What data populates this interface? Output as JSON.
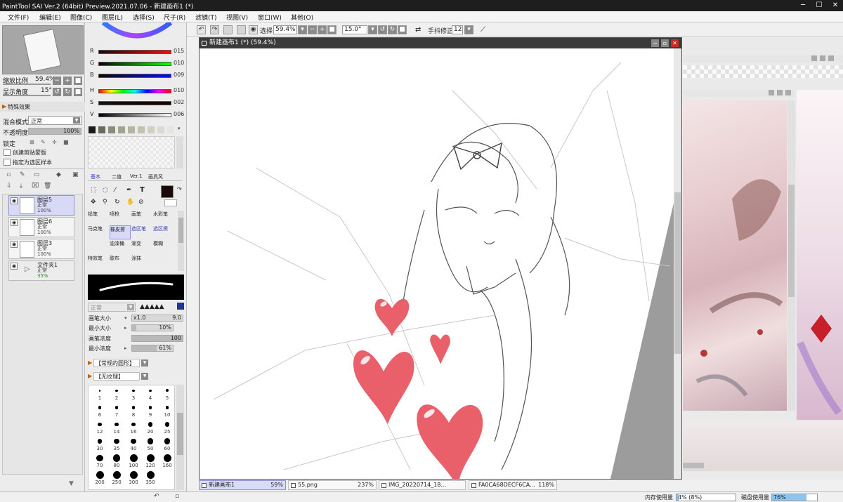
{
  "window": {
    "title": "PaintTool SAI Ver.2 (64bit) Preview.2021.07.06 - 新建画布1 (*)",
    "min": "─",
    "max": "☐",
    "close": "✕"
  },
  "menu": [
    "文件(F)",
    "编辑(E)",
    "图像(C)",
    "图层(L)",
    "选择(S)",
    "尺子(R)",
    "滤镜(T)",
    "视图(V)",
    "窗口(W)",
    "其他(O)"
  ],
  "navigator": {
    "zoom_label": "缩放比例",
    "zoom_value": "59.4%",
    "angle_label": "显示角度",
    "angle_value": "15°",
    "zoom_fraction": 0.594
  },
  "effects": {
    "label": "特殊效果"
  },
  "layer_props": {
    "blend_label": "混合模式",
    "blend_value": "正常",
    "opacity_label": "不透明度",
    "opacity_value": "100%",
    "lock_label": "锁定",
    "clip_label": "创建剪贴蒙版",
    "select_src_label": "指定为选区样本"
  },
  "layers": [
    {
      "name": "图层5",
      "mode": "正常",
      "opacity": "100%",
      "selected": true,
      "visible": true
    },
    {
      "name": "图层6",
      "mode": "正常",
      "opacity": "100%",
      "selected": false,
      "visible": true
    },
    {
      "name": "图层3",
      "mode": "正常",
      "opacity": "100%",
      "selected": false,
      "visible": true
    },
    {
      "name": "文件夹1",
      "mode": "正常",
      "opacity": "35%",
      "selected": false,
      "visible": true,
      "folder": true
    }
  ],
  "color": {
    "rgb": [
      {
        "label": "R",
        "value": "015"
      },
      {
        "label": "G",
        "value": "010"
      },
      {
        "label": "B",
        "value": "009"
      }
    ],
    "hsv": [
      {
        "label": "H",
        "value": "010"
      },
      {
        "label": "S",
        "value": "002"
      },
      {
        "label": "V",
        "value": "006"
      }
    ],
    "current": "#1a0a09",
    "swatches": [
      "#1a1a1a",
      "#6b6b5c",
      "#8c8c7a",
      "#a3a38f",
      "#b5b5a3",
      "#c2c2b3",
      "#cfcfc2",
      "#dadad0",
      "#e6e6e0"
    ]
  },
  "tool_tabs": [
    "基本",
    "二值",
    "Ver.1",
    "画具风"
  ],
  "tool_icons": [
    "select-rect-icon",
    "lasso-icon",
    "magic-wand-icon",
    "eyedropper-icon",
    "text-icon",
    "move-icon",
    "zoom-icon",
    "rotate-icon",
    "hand-icon",
    "color-picker-icon"
  ],
  "brushes": [
    {
      "name": "铅笔"
    },
    {
      "name": "喷枪"
    },
    {
      "name": "画笔"
    },
    {
      "name": "水彩笔"
    },
    {
      "name": "马克笔"
    },
    {
      "name": "橡皮擦",
      "selected": true
    },
    {
      "name": "选区笔",
      "blue": true
    },
    {
      "name": "选区擦",
      "blue": true
    },
    {
      "name": ""
    },
    {
      "name": "油漆桶"
    },
    {
      "name": "渐变"
    },
    {
      "name": "模糊"
    },
    {
      "name": "特效笔"
    },
    {
      "name": "歌布"
    },
    {
      "name": "涂抹"
    },
    {
      "name": ""
    }
  ],
  "brush_settings": {
    "mode_value": "正常",
    "size_label": "画笔大小",
    "size_mult": "x1.0",
    "size_value": "9.0",
    "min_size_label": "最小大小",
    "min_size_value": "10%",
    "density_label": "画笔浓度",
    "density_value": "100",
    "min_density_label": "最小浓度",
    "min_density_value": "61%",
    "shape_label": "【常规的圆形】",
    "texture_label": "【无纹理】"
  },
  "brush_dots": [
    "1",
    "2",
    "3",
    "4",
    "5",
    "6",
    "7",
    "8",
    "9",
    "10",
    "12",
    "14",
    "16",
    "20",
    "25",
    "30",
    "35",
    "40",
    "50",
    "60",
    "70",
    "80",
    "100",
    "120",
    "160",
    "200",
    "250",
    "300",
    "350"
  ],
  "toolbar": {
    "select_label": "选择",
    "zoom": "59.4%",
    "angle": "15.0°",
    "stabilizer_label": "手抖修正",
    "stabilizer": "12"
  },
  "canvas": {
    "title": "新建画布1 (*) (59.4%)",
    "bg": "#9c9c9c",
    "heart_color": "#e9606b"
  },
  "canvas_tabs": [
    {
      "name": "新建画布1",
      "pct": "59%",
      "active": true
    },
    {
      "name": "55.png",
      "pct": "237%"
    },
    {
      "name": "IMG_20220714_18...",
      "pct": ""
    },
    {
      "name": "FA0CA68DECF6CA...",
      "pct": "118%"
    }
  ],
  "status": {
    "mem_label": "内存使用量",
    "mem_value": "4% (8%)",
    "mem_fraction": 0.04,
    "disk_label": "磁盘使用量",
    "disk_value": "76%",
    "disk_fraction": 0.76
  }
}
